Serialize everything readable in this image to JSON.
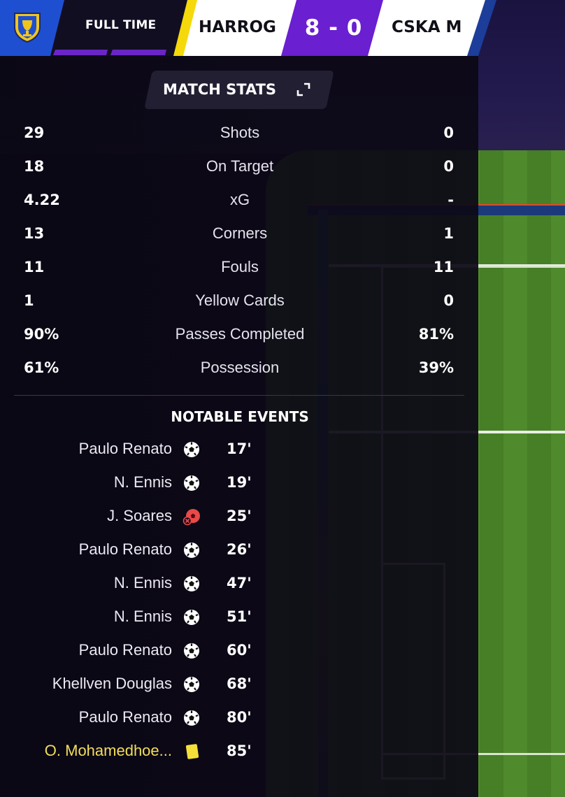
{
  "header": {
    "status": "FULL TIME",
    "home_team": "HARROG",
    "score": "8 - 0",
    "away_team": "CSKA M",
    "colors": {
      "home_accent": "#f5d90a",
      "score_bg": "#6a1fd0",
      "away_accent": "#1c3d9a",
      "logo_bg": "#1f4fd1"
    },
    "logo_icon": "competition-trophy-icon"
  },
  "match_stats": {
    "title": "MATCH STATS",
    "expand_icon": "expand-icon",
    "rows": [
      {
        "label": "Shots",
        "home": "29",
        "away": "0"
      },
      {
        "label": "On Target",
        "home": "18",
        "away": "0"
      },
      {
        "label": "xG",
        "home": "4.22",
        "away": "-"
      },
      {
        "label": "Corners",
        "home": "13",
        "away": "1"
      },
      {
        "label": "Fouls",
        "home": "11",
        "away": "11"
      },
      {
        "label": "Yellow Cards",
        "home": "1",
        "away": "0"
      },
      {
        "label": "Passes Completed",
        "home": "90%",
        "away": "81%"
      },
      {
        "label": "Possession",
        "home": "61%",
        "away": "39%"
      }
    ]
  },
  "notable_events": {
    "title": "NOTABLE EVENTS",
    "events": [
      {
        "player": "Paulo Renato",
        "type": "goal",
        "icon": "football-icon",
        "minute": "17'"
      },
      {
        "player": "N. Ennis",
        "type": "goal",
        "icon": "football-icon",
        "minute": "19'"
      },
      {
        "player": "J. Soares",
        "type": "missed-penalty",
        "icon": "missed-penalty-icon",
        "minute": "25'"
      },
      {
        "player": "Paulo Renato",
        "type": "goal",
        "icon": "football-icon",
        "minute": "26'"
      },
      {
        "player": "N. Ennis",
        "type": "goal",
        "icon": "football-icon",
        "minute": "47'"
      },
      {
        "player": "N. Ennis",
        "type": "goal",
        "icon": "football-icon",
        "minute": "51'"
      },
      {
        "player": "Paulo Renato",
        "type": "goal",
        "icon": "football-icon",
        "minute": "60'"
      },
      {
        "player": "Khellven Douglas",
        "type": "goal",
        "icon": "football-icon",
        "minute": "68'"
      },
      {
        "player": "Paulo Renato",
        "type": "goal",
        "icon": "football-icon",
        "minute": "80'"
      },
      {
        "player": "O. Mohamedhoe...",
        "type": "yellow-card",
        "icon": "yellow-card-icon",
        "minute": "85'"
      }
    ]
  }
}
